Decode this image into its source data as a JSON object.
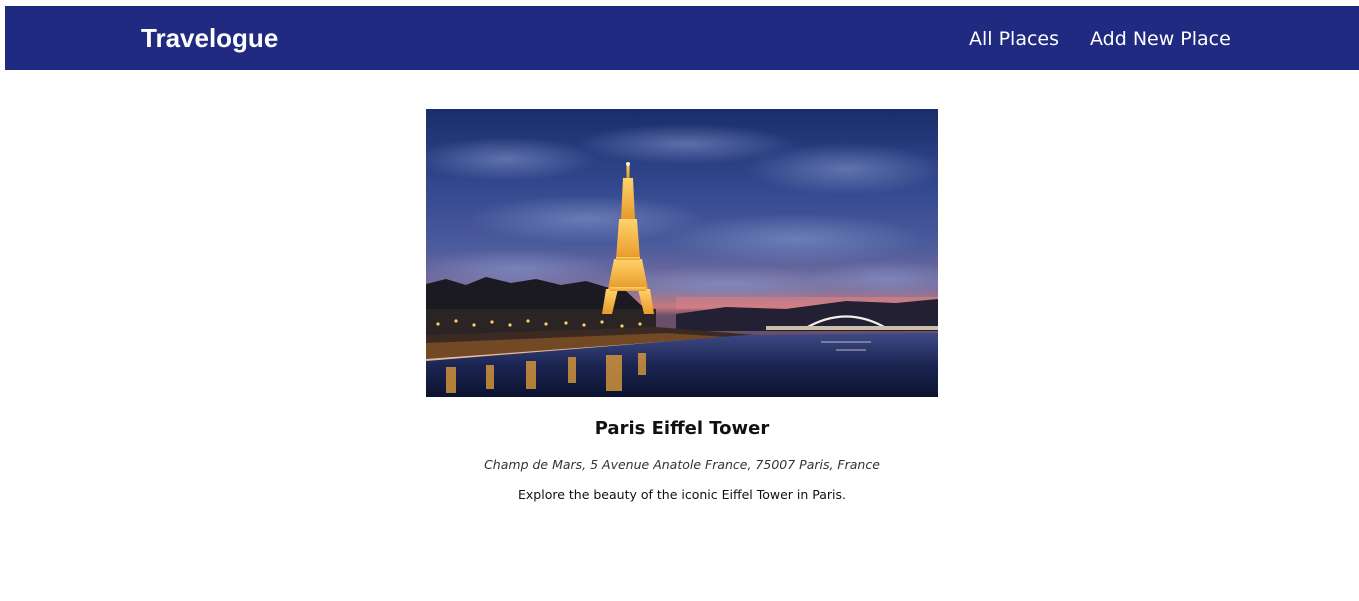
{
  "header": {
    "brand": "Travelogue",
    "nav": {
      "all_places": "All Places",
      "add_new_place": "Add New Place"
    },
    "background_color": "#1f2a80"
  },
  "place": {
    "title": "Paris Eiffel Tower",
    "address": "Champ de Mars, 5 Avenue Anatole France, 75007 Paris, France",
    "description": "Explore the beauty of the iconic Eiffel Tower in Paris.",
    "image_alt": "Eiffel Tower at dusk over the Seine"
  }
}
